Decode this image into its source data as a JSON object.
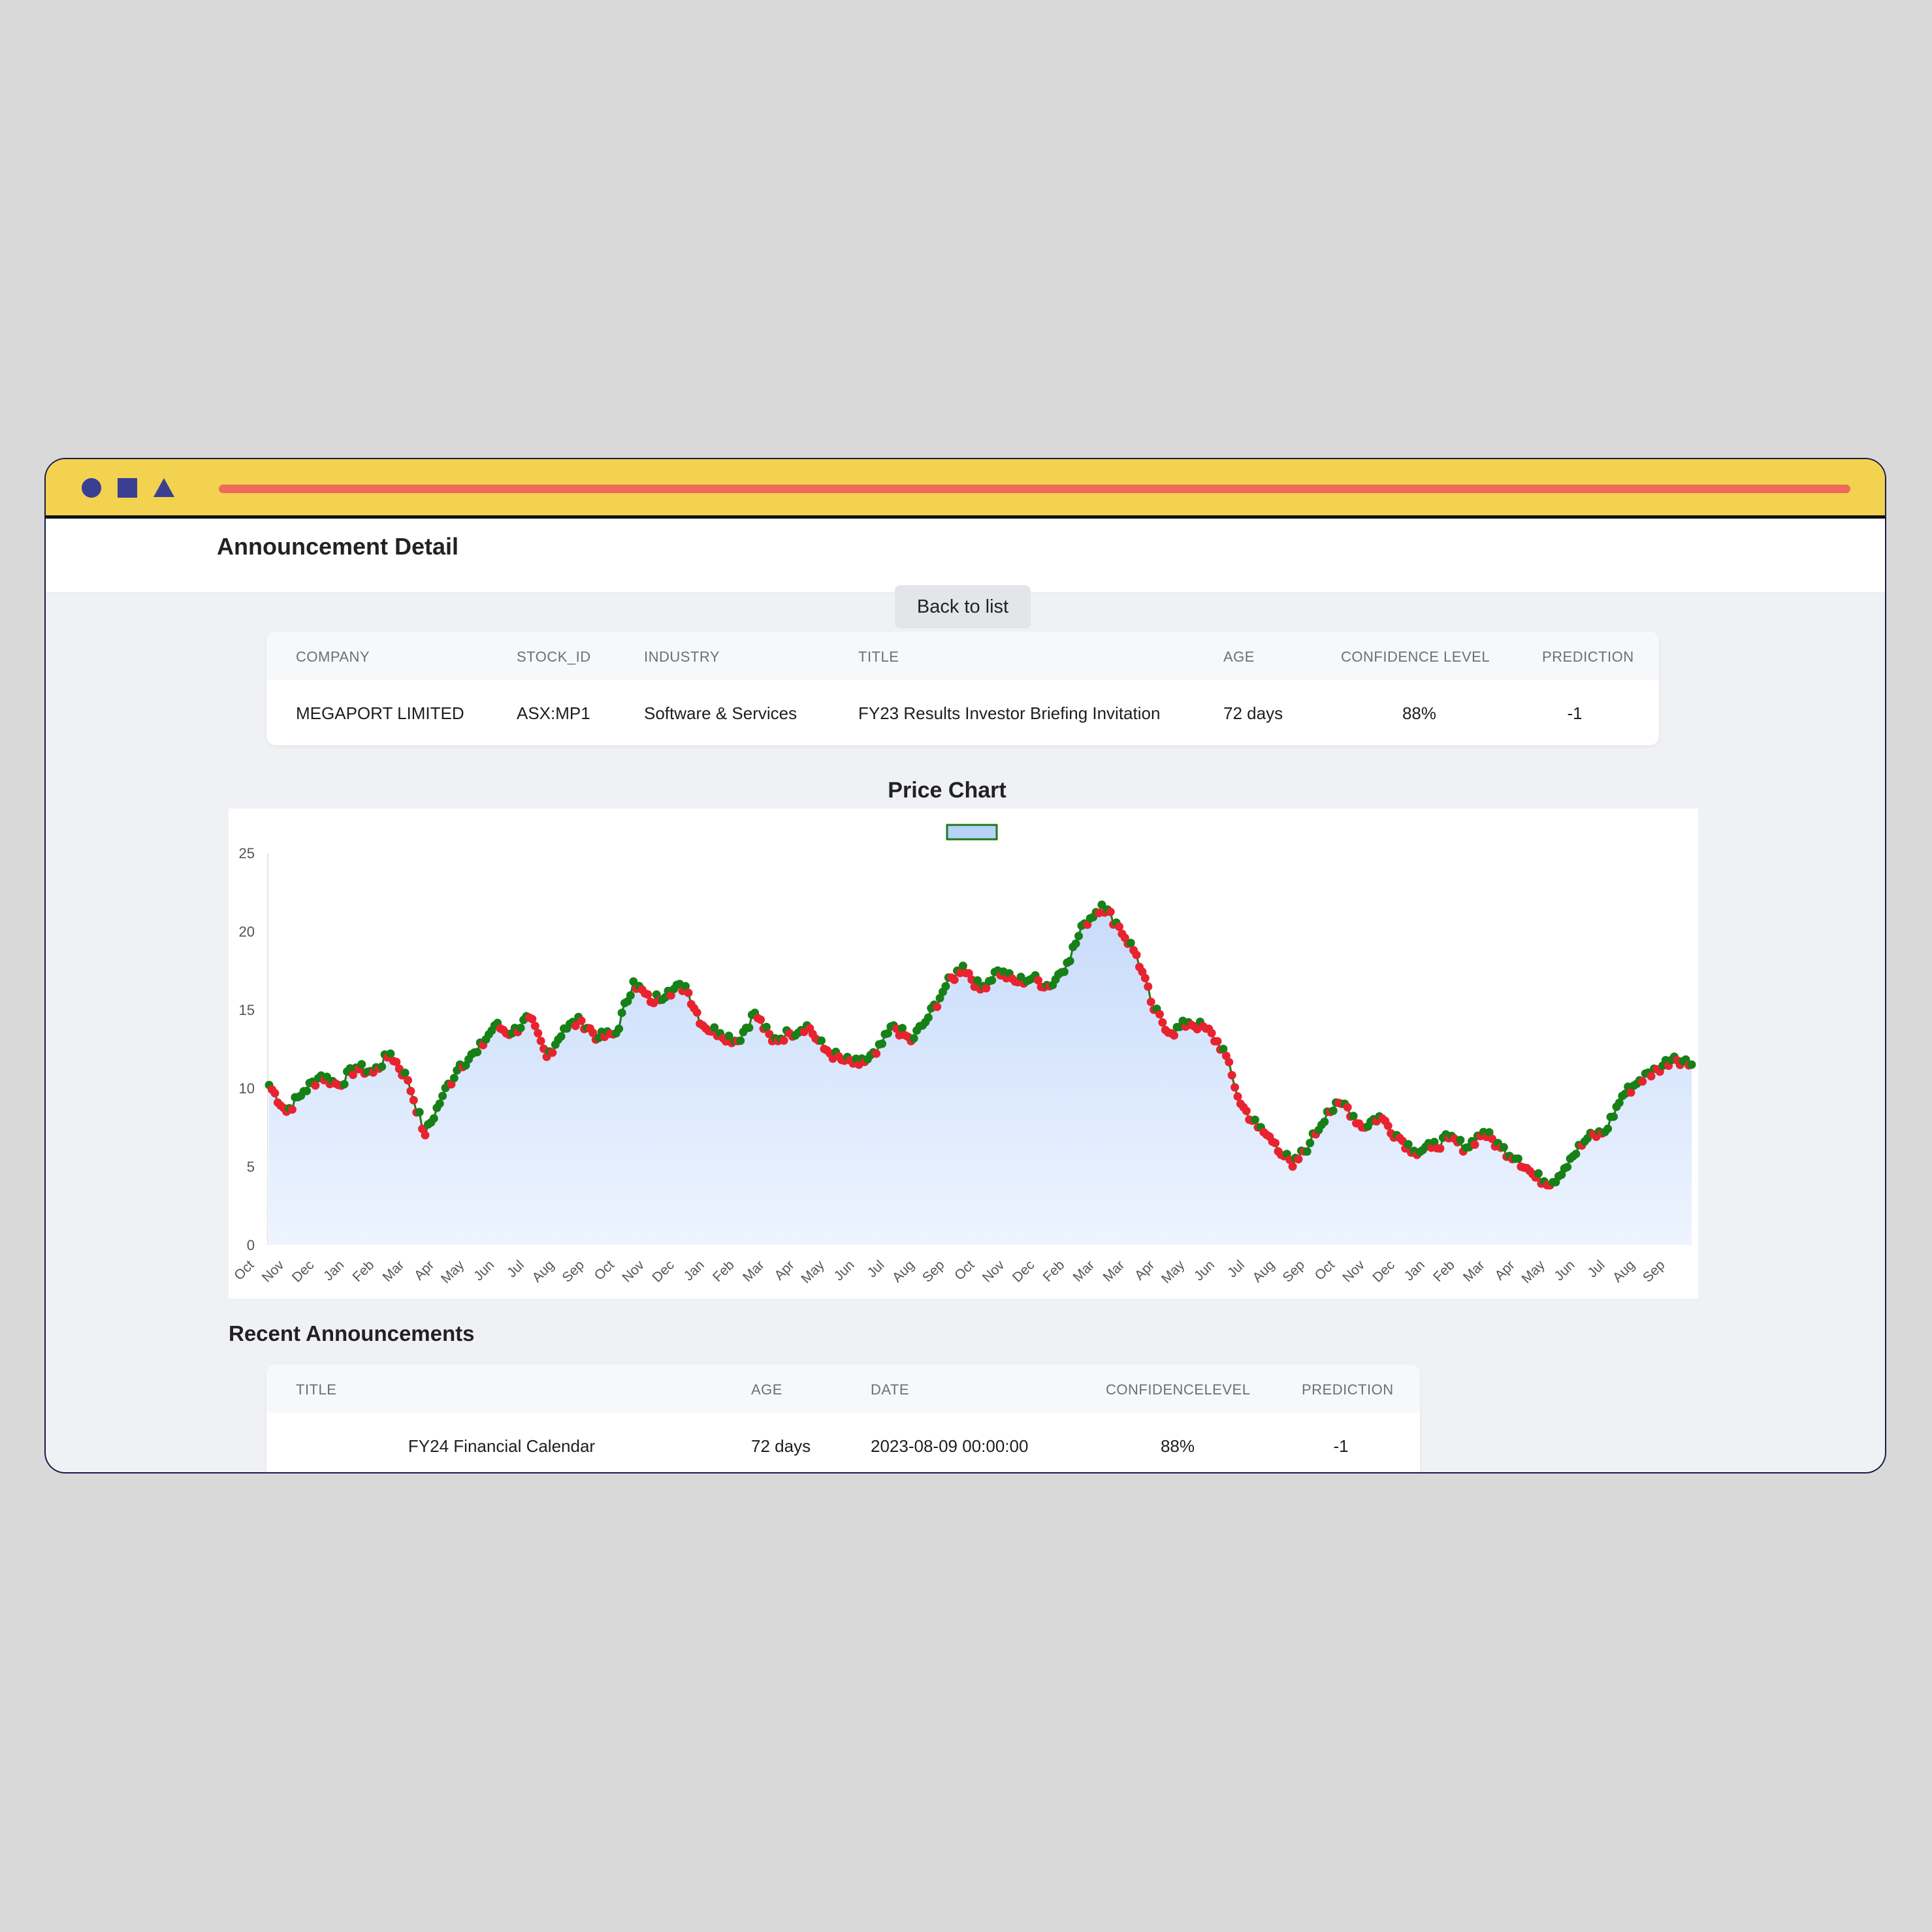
{
  "window": {
    "icons": [
      "circle-icon",
      "square-icon",
      "triangle-icon"
    ],
    "colors": {
      "titlebar": "#f2d24e",
      "shapes": "#3b3f93",
      "bar": "#ef6a5a"
    }
  },
  "header": {
    "title": "Announcement Detail"
  },
  "back_button": "Back to list",
  "detail_table": {
    "headers": [
      "COMPANY",
      "STOCK_ID",
      "INDUSTRY",
      "TITLE",
      "AGE",
      "CONFIDENCE LEVEL",
      "PREDICTION"
    ],
    "row": [
      "MEGAPORT LIMITED",
      "ASX:MP1",
      "Software & Services",
      "FY23 Results Investor Briefing Invitation",
      "72 days",
      "88%",
      "-1"
    ]
  },
  "chart_title": "Price Chart",
  "chart_data": {
    "type": "area",
    "title": "Price Chart",
    "legend": {
      "label": "",
      "placement": "top-center"
    },
    "ylim": [
      0,
      25
    ],
    "yticks": [
      0,
      5,
      10,
      15,
      20,
      25
    ],
    "xlabels": [
      "Oct",
      "Nov",
      "Dec",
      "Jan",
      "Feb",
      "Mar",
      "Apr",
      "May",
      "Jun",
      "Jul",
      "Aug",
      "Sep",
      "Oct",
      "Nov",
      "Dec",
      "Jan",
      "Feb",
      "Mar",
      "Apr",
      "May",
      "Jun",
      "Jul",
      "Aug",
      "Sep",
      "Oct",
      "Nov",
      "Dec",
      "Feb",
      "Mar",
      "Mar",
      "Apr",
      "May",
      "Jun",
      "Jul",
      "Aug",
      "Sep",
      "Oct",
      "Nov",
      "Dec",
      "Jan",
      "Feb",
      "Mar",
      "Apr",
      "May",
      "Jun",
      "Jul",
      "Aug",
      "Sep"
    ],
    "series": [
      {
        "values": [
          10.2,
          8.5,
          9.8,
          10.8,
          10.2,
          11.3,
          11.0,
          12.2,
          10.5,
          7.0,
          9.5,
          11.5,
          12.3,
          14.0,
          13.5,
          14.5,
          12.0,
          13.8,
          14.3,
          13.2,
          13.5,
          16.8,
          15.5,
          16.2,
          16.5,
          14.0,
          13.5,
          13.0,
          14.8,
          13.0,
          13.5,
          14.0,
          12.5,
          11.8,
          11.5,
          12.2,
          14.0,
          13.0,
          14.5,
          16.5,
          17.8,
          16.3,
          17.5,
          16.8,
          17.0,
          16.5,
          18.0,
          20.5,
          21.7,
          20.3,
          18.5,
          15.0,
          13.5,
          14.2,
          13.8,
          12.5,
          9.0,
          7.5,
          6.5,
          5.0,
          6.5,
          8.5,
          9.0,
          7.5,
          8.2,
          7.0,
          6.0,
          6.2,
          6.8,
          6.2,
          7.2,
          6.2,
          5.5,
          4.3,
          4.0,
          5.5,
          6.8,
          7.2,
          9.5,
          10.5,
          11.2,
          12.0,
          11.5
        ]
      }
    ],
    "colors": {
      "line": "#1e7a1e",
      "up": "#178017",
      "down": "#e8232f",
      "fill_top": "#c7dbfa",
      "fill_bottom": "#eef4ff"
    },
    "grid": false
  },
  "recent": {
    "title": "Recent Announcements",
    "headers": [
      "TITLE",
      "AGE",
      "DATE",
      "CONFIDENCELEVEL",
      "PREDICTION"
    ],
    "rows": [
      [
        "FY24 Financial Calendar",
        "72 days",
        "2023-08-09 00:00:00",
        "88%",
        "-1"
      ]
    ]
  }
}
